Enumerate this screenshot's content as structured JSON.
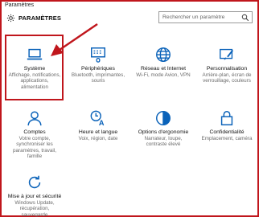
{
  "window": {
    "title": "Paramètres"
  },
  "header": {
    "app_title": "PARAMÈTRES"
  },
  "search": {
    "placeholder": "Rechercher un paramètre"
  },
  "tiles": [
    {
      "label": "Système",
      "desc": [
        "Affichage, notifications,",
        "applications,",
        "alimentation"
      ],
      "icon": "laptop-icon"
    },
    {
      "label": "Périphériques",
      "desc": [
        "Bluetooth, imprimantes,",
        "souris"
      ],
      "icon": "devices-icon"
    },
    {
      "label": "Réseau et Internet",
      "desc": [
        "Wi-Fi, mode Avion, VPN"
      ],
      "icon": "globe-icon"
    },
    {
      "label": "Personnalisation",
      "desc": [
        "Arrière-plan, écran de",
        "verrouillage, couleurs"
      ],
      "icon": "paintbrush-icon"
    },
    {
      "label": "Comptes",
      "desc": [
        "Votre compte,",
        "synchroniser les",
        "paramètres, travail,",
        "famille"
      ],
      "icon": "person-icon"
    },
    {
      "label": "Heure et langue",
      "desc": [
        "Voix, région, date"
      ],
      "icon": "clock-language-icon"
    },
    {
      "label": "Options d'ergonomie",
      "desc": [
        "Narrateur, loupe,",
        "contraste élevé"
      ],
      "icon": "accessibility-icon"
    },
    {
      "label": "Confidentialité",
      "desc": [
        "Emplacement, caméra"
      ],
      "icon": "lock-icon"
    },
    {
      "label": "Mise à jour et sécurité",
      "desc": [
        "Windows Update,",
        "récupération,",
        "sauvegarde"
      ],
      "icon": "update-icon"
    }
  ],
  "colors": {
    "accent": "#0a62b9",
    "annotation": "#c0161c"
  }
}
